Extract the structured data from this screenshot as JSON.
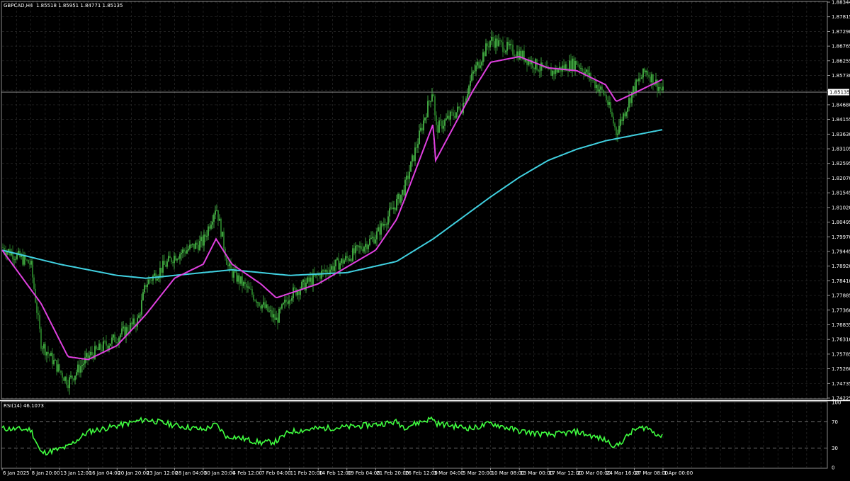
{
  "window": {
    "symbol_info": "GBPCAD,H4",
    "ohlc": "1.85518 1.85951 1.84771 1.85135"
  },
  "colors": {
    "background": "#000000",
    "grid": "#2a2a2a",
    "candle_bull": "#4fc84f",
    "candle_bear": "#2e8b2e",
    "ma_fast": "#e040e0",
    "ma_slow": "#40d0e0",
    "rsi_line": "#40ff40",
    "price_label_bg": "#ffffff"
  },
  "price_axis": {
    "labels": [
      "1.88344",
      "1.87815",
      "1.87290",
      "1.86765",
      "1.86255",
      "1.85730",
      "1.85135",
      "1.84680",
      "1.84155",
      "1.83630",
      "1.83105",
      "1.82595",
      "1.82070",
      "1.81545",
      "1.81020",
      "1.80495",
      "1.79970",
      "1.79445",
      "1.78920",
      "1.78410",
      "1.77885",
      "1.77360",
      "1.76835",
      "1.76310",
      "1.75785",
      "1.75260",
      "1.74735",
      "1.74225"
    ],
    "current_price": "1.85135"
  },
  "rsi": {
    "title": "RSI(14) 46.1073",
    "levels": [
      "100",
      "70",
      "30",
      "0"
    ]
  },
  "time_axis": {
    "labels": [
      "6 Jan 2025",
      "8 Jan 20:00",
      "13 Jan 12:00",
      "16 Jan 04:00",
      "20 Jan 20:00",
      "23 Jan 12:00",
      "28 Jan 04:00",
      "30 Jan 20:00",
      "4 Feb 12:00",
      "7 Feb 04:00",
      "11 Feb 20:00",
      "14 Feb 12:00",
      "19 Feb 04:00",
      "21 Feb 20:00",
      "26 Feb 12:00",
      "3 Mar 04:00",
      "5 Mar 20:00",
      "10 Mar 08:00",
      "13 Mar 00:00",
      "17 Mar 12:00",
      "20 Mar 00:00",
      "24 Mar 16:00",
      "27 Mar 08:00",
      "1 Apr 00:00"
    ]
  },
  "chart_data": {
    "type": "candlestick",
    "symbol": "GBPCAD",
    "timeframe": "H4",
    "x_range": [
      "6 Jan 2025",
      "1 Apr 00:00"
    ],
    "ylim": [
      1.74225,
      1.88344
    ],
    "close_path": [
      {
        "x": "6 Jan 2025",
        "y": 1.796
      },
      {
        "x": "8 Jan 20:00",
        "y": 1.79
      },
      {
        "x": "10 Jan",
        "y": 1.762
      },
      {
        "x": "13 Jan 12:00",
        "y": 1.752
      },
      {
        "x": "14 Jan",
        "y": 1.748
      },
      {
        "x": "16 Jan 04:00",
        "y": 1.757
      },
      {
        "x": "20 Jan 20:00",
        "y": 1.764
      },
      {
        "x": "22 Jan",
        "y": 1.77
      },
      {
        "x": "23 Jan 12:00",
        "y": 1.783
      },
      {
        "x": "28 Jan 04:00",
        "y": 1.793
      },
      {
        "x": "30 Jan 20:00",
        "y": 1.798
      },
      {
        "x": "31 Jan",
        "y": 1.811
      },
      {
        "x": "3 Feb",
        "y": 1.789
      },
      {
        "x": "4 Feb 12:00",
        "y": 1.787
      },
      {
        "x": "7 Feb 04:00",
        "y": 1.776
      },
      {
        "x": "10 Feb",
        "y": 1.77
      },
      {
        "x": "11 Feb 20:00",
        "y": 1.779
      },
      {
        "x": "14 Feb 12:00",
        "y": 1.786
      },
      {
        "x": "19 Feb 04:00",
        "y": 1.792
      },
      {
        "x": "21 Feb 20:00",
        "y": 1.8
      },
      {
        "x": "24 Feb",
        "y": 1.812
      },
      {
        "x": "26 Feb 12:00",
        "y": 1.817
      },
      {
        "x": "28 Feb",
        "y": 1.838
      },
      {
        "x": "3 Mar 04:00",
        "y": 1.853
      },
      {
        "x": "5 Mar 20:00",
        "y": 1.846
      },
      {
        "x": "7 Mar",
        "y": 1.858
      },
      {
        "x": "10 Mar 08:00",
        "y": 1.87
      },
      {
        "x": "13 Mar 00:00",
        "y": 1.865
      },
      {
        "x": "17 Mar 12:00",
        "y": 1.858
      },
      {
        "x": "20 Mar 00:00",
        "y": 1.862
      },
      {
        "x": "24 Mar 16:00",
        "y": 1.85
      },
      {
        "x": "25 Mar",
        "y": 1.837
      },
      {
        "x": "27 Mar 08:00",
        "y": 1.853
      },
      {
        "x": "31 Mar",
        "y": 1.859
      },
      {
        "x": "1 Apr 00:00",
        "y": 1.85135
      }
    ],
    "ma_fast": [
      {
        "x": "6 Jan 2025",
        "y": 1.795
      },
      {
        "x": "10 Jan",
        "y": 1.776
      },
      {
        "x": "14 Jan",
        "y": 1.757
      },
      {
        "x": "16 Jan 04:00",
        "y": 1.756
      },
      {
        "x": "20 Jan 20:00",
        "y": 1.761
      },
      {
        "x": "23 Jan 12:00",
        "y": 1.772
      },
      {
        "x": "28 Jan 04:00",
        "y": 1.785
      },
      {
        "x": "30 Jan 20:00",
        "y": 1.79
      },
      {
        "x": "31 Jan",
        "y": 1.799
      },
      {
        "x": "4 Feb 12:00",
        "y": 1.79
      },
      {
        "x": "7 Feb 04:00",
        "y": 1.783
      },
      {
        "x": "10 Feb",
        "y": 1.778
      },
      {
        "x": "14 Feb 12:00",
        "y": 1.783
      },
      {
        "x": "19 Feb 04:00",
        "y": 1.789
      },
      {
        "x": "21 Feb 20:00",
        "y": 1.795
      },
      {
        "x": "24 Feb",
        "y": 1.806
      },
      {
        "x": "26 Feb 12:00",
        "y": 1.813
      },
      {
        "x": "28 Feb",
        "y": 1.827
      },
      {
        "x": "3 Mar 04:00",
        "y": 1.84
      },
      {
        "x": "7 Mar",
        "y": 1.852
      },
      {
        "x": "10 Mar 08:00",
        "y": 1.862
      },
      {
        "x": "13 Mar 00:00",
        "y": 1.864
      },
      {
        "x": "17 Mar 12:00",
        "y": 1.86
      },
      {
        "x": "20 Mar 00:00",
        "y": 1.859
      },
      {
        "x": "24 Mar 16:00",
        "y": 1.854
      },
      {
        "x": "25 Mar",
        "y": 1.848
      },
      {
        "x": "27 Mar 08:00",
        "y": 1.851
      },
      {
        "x": "1 Apr 00:00",
        "y": 1.856
      }
    ],
    "ma_slow": [
      {
        "x": "6 Jan 2025",
        "y": 1.795
      },
      {
        "x": "13 Jan 12:00",
        "y": 1.79
      },
      {
        "x": "20 Jan 20:00",
        "y": 1.786
      },
      {
        "x": "23 Jan 12:00",
        "y": 1.785
      },
      {
        "x": "30 Jan 20:00",
        "y": 1.787
      },
      {
        "x": "4 Feb 12:00",
        "y": 1.788
      },
      {
        "x": "11 Feb 20:00",
        "y": 1.786
      },
      {
        "x": "19 Feb 04:00",
        "y": 1.787
      },
      {
        "x": "24 Feb",
        "y": 1.791
      },
      {
        "x": "3 Mar 04:00",
        "y": 1.799
      },
      {
        "x": "10 Mar 08:00",
        "y": 1.814
      },
      {
        "x": "13 Mar 00:00",
        "y": 1.821
      },
      {
        "x": "17 Mar 12:00",
        "y": 1.827
      },
      {
        "x": "20 Mar 00:00",
        "y": 1.831
      },
      {
        "x": "24 Mar 16:00",
        "y": 1.834
      },
      {
        "x": "27 Mar 08:00",
        "y": 1.836
      },
      {
        "x": "1 Apr 00:00",
        "y": 1.838
      }
    ],
    "rsi_series": [
      {
        "x": "6 Jan 2025",
        "y": 60
      },
      {
        "x": "8 Jan 20:00",
        "y": 58
      },
      {
        "x": "10 Jan",
        "y": 22
      },
      {
        "x": "13 Jan 12:00",
        "y": 28
      },
      {
        "x": "14 Jan",
        "y": 32
      },
      {
        "x": "16 Jan 04:00",
        "y": 55
      },
      {
        "x": "20 Jan 20:00",
        "y": 64
      },
      {
        "x": "23 Jan 12:00",
        "y": 74
      },
      {
        "x": "28 Jan 04:00",
        "y": 65
      },
      {
        "x": "30 Jan 20:00",
        "y": 58
      },
      {
        "x": "31 Jan",
        "y": 66
      },
      {
        "x": "3 Feb",
        "y": 45
      },
      {
        "x": "4 Feb 12:00",
        "y": 48
      },
      {
        "x": "7 Feb 04:00",
        "y": 38
      },
      {
        "x": "10 Feb",
        "y": 40
      },
      {
        "x": "11 Feb 20:00",
        "y": 55
      },
      {
        "x": "14 Feb 12:00",
        "y": 60
      },
      {
        "x": "19 Feb 04:00",
        "y": 62
      },
      {
        "x": "21 Feb 20:00",
        "y": 66
      },
      {
        "x": "24 Feb",
        "y": 70
      },
      {
        "x": "26 Feb 12:00",
        "y": 62
      },
      {
        "x": "28 Feb",
        "y": 68
      },
      {
        "x": "3 Mar 04:00",
        "y": 76
      },
      {
        "x": "5 Mar 20:00",
        "y": 62
      },
      {
        "x": "7 Mar",
        "y": 60
      },
      {
        "x": "10 Mar 08:00",
        "y": 68
      },
      {
        "x": "13 Mar 00:00",
        "y": 56
      },
      {
        "x": "17 Mar 12:00",
        "y": 50
      },
      {
        "x": "20 Mar 00:00",
        "y": 55
      },
      {
        "x": "24 Mar 16:00",
        "y": 42
      },
      {
        "x": "25 Mar",
        "y": 32
      },
      {
        "x": "27 Mar 08:00",
        "y": 58
      },
      {
        "x": "31 Mar",
        "y": 62
      },
      {
        "x": "1 Apr 00:00",
        "y": 46.1073
      }
    ]
  }
}
